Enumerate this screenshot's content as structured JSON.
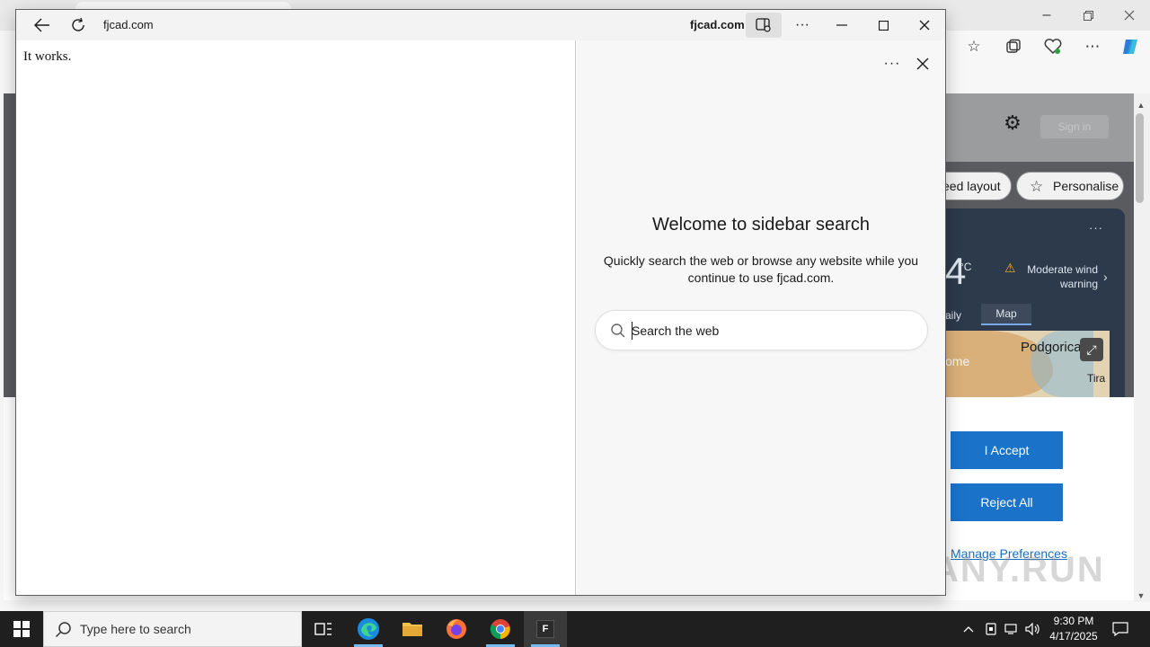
{
  "app_window": {
    "url": "fjcad.com",
    "site_name": "fjcad.com",
    "page_text": "It works."
  },
  "sidebar": {
    "title": "Welcome to sidebar search",
    "description": "Quickly search the web or browse any website while you continue to use fjcad.com.",
    "search_placeholder": "Search the web"
  },
  "background_page": {
    "pills": {
      "layout": "eed layout",
      "personalise": "Personalise"
    },
    "signin_label": "Sign in",
    "weather": {
      "temp_partial": "4",
      "unit": "°C",
      "warning": "Moderate wind warning",
      "tab_daily": "aily",
      "tab_map": "Map",
      "map_labels": [
        "Podgorica",
        "ome",
        "Tira"
      ]
    },
    "consent": {
      "accept": "I Accept",
      "reject": "Reject All",
      "manage": "Manage Preferences"
    },
    "watermark": "ANY.RUN"
  },
  "taskbar": {
    "search_placeholder": "Type here to search",
    "f_app_letter": "F",
    "time": "9:30 PM",
    "date": "4/17/2025"
  },
  "colors": {
    "accent": "#1a73c8",
    "taskbar": "#1f1f1f",
    "sidebar_bg": "#f7f7f7"
  }
}
